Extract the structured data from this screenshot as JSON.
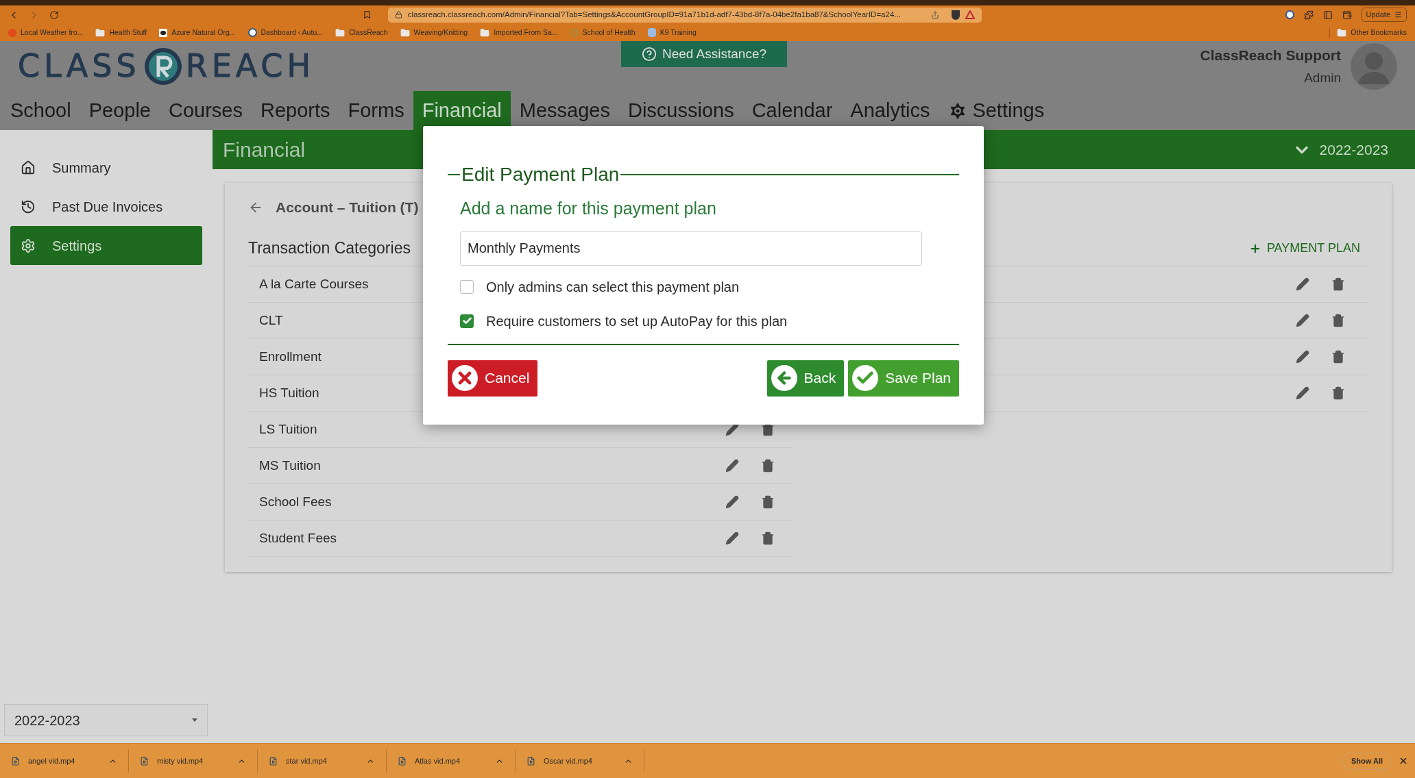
{
  "browser": {
    "url": "classreach.classreach.com/Admin/Financial?Tab=Settings&AccountGroupID=91a71b1d-adf7-43bd-8f7a-04be2fa1ba87&SchoolYearID=a24...",
    "update_button": "Update",
    "bookmarks": [
      {
        "label": "Local Weather fro...",
        "kind": "dot"
      },
      {
        "label": "Health Stuff",
        "kind": "folder"
      },
      {
        "label": "Azure Natural Org...",
        "kind": "bird"
      },
      {
        "label": "Dashboard ‹ Autu...",
        "kind": "wp"
      },
      {
        "label": "ClassReach",
        "kind": "folder"
      },
      {
        "label": "Weaving/Knitting",
        "kind": "folder"
      },
      {
        "label": "Imported From Sa...",
        "kind": "folder"
      },
      {
        "label": "School of Health",
        "kind": "ring"
      },
      {
        "label": "K9 Training",
        "kind": "badge"
      }
    ],
    "other_bookmarks": "Other Bookmarks"
  },
  "header": {
    "logo_left": "CLASS",
    "logo_right": "REACH",
    "help_button": "Need Assistance?",
    "user_name": "ClassReach Support",
    "user_role": "Admin"
  },
  "nav": [
    {
      "label": "School",
      "selected": false,
      "kind": "text"
    },
    {
      "label": "People",
      "selected": false,
      "kind": "text"
    },
    {
      "label": "Courses",
      "selected": false,
      "kind": "text"
    },
    {
      "label": "Reports",
      "selected": false,
      "kind": "text"
    },
    {
      "label": "Forms",
      "selected": false,
      "kind": "text"
    },
    {
      "label": "Financial",
      "selected": true,
      "kind": "text"
    },
    {
      "label": "Messages",
      "selected": false,
      "kind": "text"
    },
    {
      "label": "Discussions",
      "selected": false,
      "kind": "text"
    },
    {
      "label": "Calendar",
      "selected": false,
      "kind": "text"
    },
    {
      "label": "Analytics",
      "selected": false,
      "kind": "text"
    },
    {
      "label": "Settings",
      "selected": false,
      "kind": "gear"
    }
  ],
  "section": {
    "title": "Financial",
    "year": "2022-2023"
  },
  "sidebar": {
    "items": [
      {
        "label": "Summary",
        "selected": false,
        "kind": "home"
      },
      {
        "label": "Past Due Invoices",
        "selected": false,
        "kind": "history"
      },
      {
        "label": "Settings",
        "selected": true,
        "kind": "gear"
      }
    ],
    "year_select": "2022-2023"
  },
  "account": {
    "title": "Account – Tuition (T)",
    "heading": "Transaction Categories",
    "add_button": "PAYMENT PLAN",
    "rows": [
      {
        "name": "A la Carte Courses",
        "kind": "wide"
      },
      {
        "name": "CLT",
        "kind": "wide"
      },
      {
        "name": "Enrollment",
        "kind": "wide"
      },
      {
        "name": "HS Tuition",
        "kind": "wide"
      },
      {
        "name": "LS Tuition",
        "kind": "narrow"
      },
      {
        "name": "MS Tuition",
        "kind": "narrow"
      },
      {
        "name": "School Fees",
        "kind": "narrow"
      },
      {
        "name": "Student Fees",
        "kind": "narrow"
      }
    ]
  },
  "modal": {
    "title": "Edit Payment Plan",
    "prompt": "Add a name for this payment plan",
    "name_value": "Monthly Payments",
    "options": [
      {
        "label": "Only admins can select this payment plan",
        "checked": false
      },
      {
        "label": "Require customers to set up AutoPay for this plan",
        "checked": true
      }
    ],
    "cancel": "Cancel",
    "back": "Back",
    "save": "Save Plan"
  },
  "downloads": {
    "files": [
      "angel vid.mp4",
      "misty vid.mp4",
      "star vid.mp4",
      "Atlas vid.mp4",
      "Oscar vid.mp4"
    ],
    "show_all": "Show All"
  }
}
